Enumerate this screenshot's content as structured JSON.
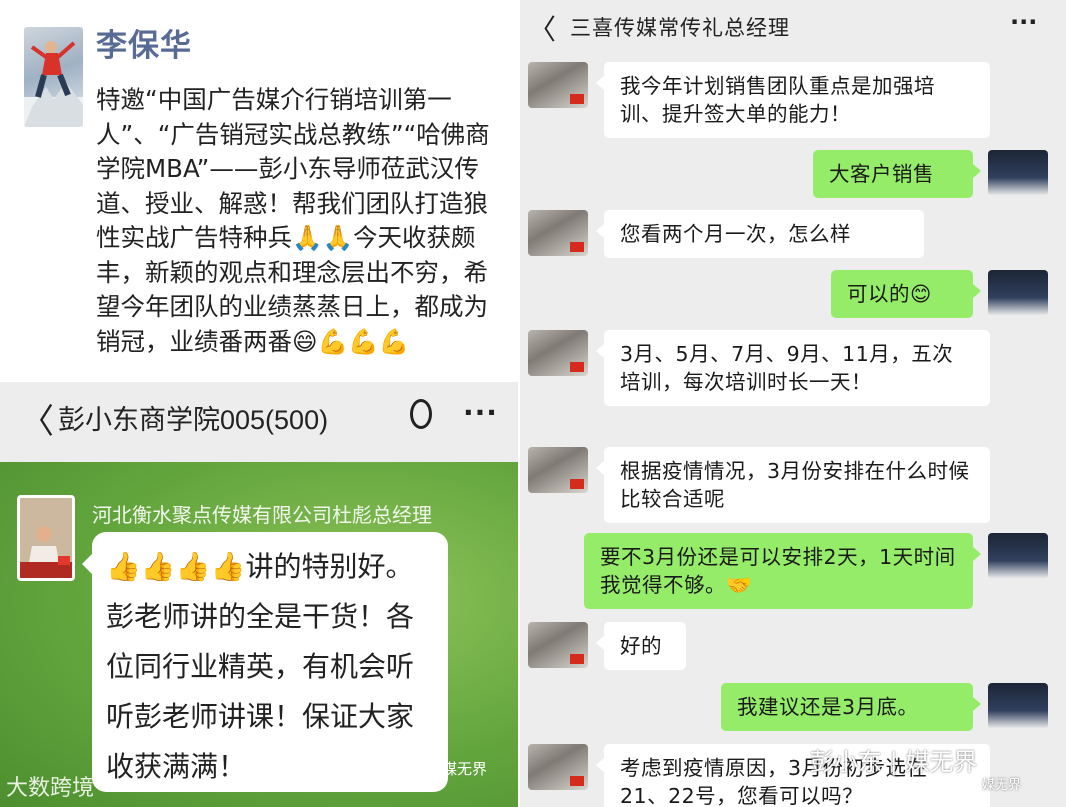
{
  "moment": {
    "name": "李保华",
    "text": "特邀“中国广告媒介行销培训第一人”、“广告销冠实战总教练”“哈佛商学院MBA”——彭小东导师莅武汉传道、授业、解惑！帮我们团队打造狼性实战广告特种兵🙏🙏今天收获颇丰，新颖的观点和理念层出不穷，希望今年团队的业绩蒸蒸日上，都成为销冠，业绩番两番😄💪💪💪"
  },
  "group": {
    "title": "彭小东商学院005(500)",
    "sender": "河北衡水聚点传媒有限公司杜彪总经理",
    "message": "👍👍👍👍讲的特别好。彭老师讲的全是干货！各位同行业精英，有机会听听彭老师讲课！保证大家收获满满！",
    "watermark": "媒无界",
    "logo": "大数跨境"
  },
  "chat": {
    "title": "三喜传媒常传礼总经理",
    "messages": [
      {
        "dir": "in",
        "text": "我今年计划销售团队重点是加强培训、提升签大单的能力！"
      },
      {
        "dir": "out",
        "text": "大客户销售"
      },
      {
        "dir": "in",
        "text": "您看两个月一次，怎么样"
      },
      {
        "dir": "out",
        "text": "可以的😊"
      },
      {
        "dir": "in",
        "text": "3月、5月、7月、9月、11月，五次培训，每次培训时长一天！"
      },
      {
        "dir": "in",
        "text": "根据疫情情况，3月份安排在什么时候比较合适呢"
      },
      {
        "dir": "out",
        "text": "要不3月份还是可以安排2天，1天时间我觉得不够。🤝"
      },
      {
        "dir": "in",
        "text": "好的"
      },
      {
        "dir": "out",
        "text": "我建议还是3月底。"
      },
      {
        "dir": "in",
        "text": "考虑到疫情原因，3月份初步选在21、22号，您看可以吗？"
      }
    ],
    "watermark": "彭小东 | 媒无界",
    "watermark_small": "媒无界"
  },
  "icons": {
    "back": "chevron-left-icon",
    "more": "more-dots-icon",
    "refresh": "refresh-icon"
  }
}
